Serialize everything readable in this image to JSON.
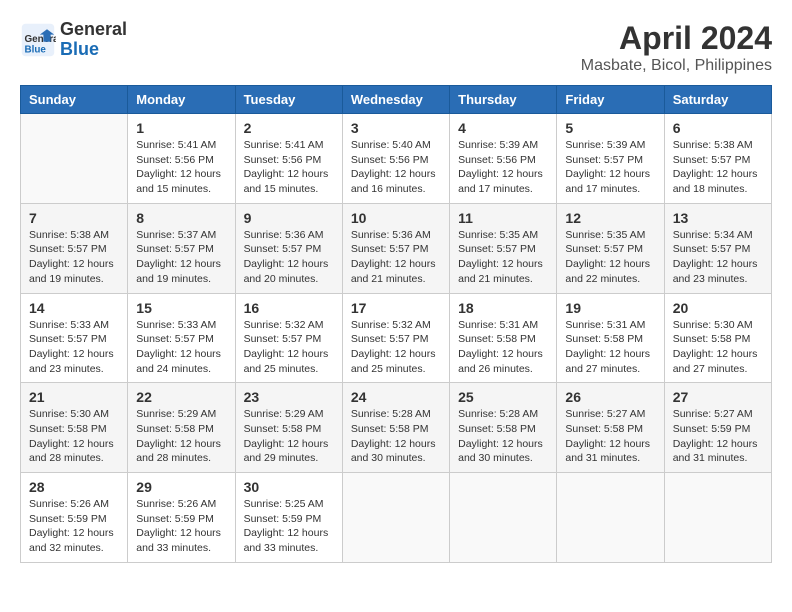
{
  "header": {
    "logo_line1": "General",
    "logo_line2": "Blue",
    "title": "April 2024",
    "subtitle": "Masbate, Bicol, Philippines"
  },
  "columns": [
    "Sunday",
    "Monday",
    "Tuesday",
    "Wednesday",
    "Thursday",
    "Friday",
    "Saturday"
  ],
  "weeks": [
    [
      {
        "day": "",
        "info": ""
      },
      {
        "day": "1",
        "info": "Sunrise: 5:41 AM\nSunset: 5:56 PM\nDaylight: 12 hours\nand 15 minutes."
      },
      {
        "day": "2",
        "info": "Sunrise: 5:41 AM\nSunset: 5:56 PM\nDaylight: 12 hours\nand 15 minutes."
      },
      {
        "day": "3",
        "info": "Sunrise: 5:40 AM\nSunset: 5:56 PM\nDaylight: 12 hours\nand 16 minutes."
      },
      {
        "day": "4",
        "info": "Sunrise: 5:39 AM\nSunset: 5:56 PM\nDaylight: 12 hours\nand 17 minutes."
      },
      {
        "day": "5",
        "info": "Sunrise: 5:39 AM\nSunset: 5:57 PM\nDaylight: 12 hours\nand 17 minutes."
      },
      {
        "day": "6",
        "info": "Sunrise: 5:38 AM\nSunset: 5:57 PM\nDaylight: 12 hours\nand 18 minutes."
      }
    ],
    [
      {
        "day": "7",
        "info": "Sunrise: 5:38 AM\nSunset: 5:57 PM\nDaylight: 12 hours\nand 19 minutes."
      },
      {
        "day": "8",
        "info": "Sunrise: 5:37 AM\nSunset: 5:57 PM\nDaylight: 12 hours\nand 19 minutes."
      },
      {
        "day": "9",
        "info": "Sunrise: 5:36 AM\nSunset: 5:57 PM\nDaylight: 12 hours\nand 20 minutes."
      },
      {
        "day": "10",
        "info": "Sunrise: 5:36 AM\nSunset: 5:57 PM\nDaylight: 12 hours\nand 21 minutes."
      },
      {
        "day": "11",
        "info": "Sunrise: 5:35 AM\nSunset: 5:57 PM\nDaylight: 12 hours\nand 21 minutes."
      },
      {
        "day": "12",
        "info": "Sunrise: 5:35 AM\nSunset: 5:57 PM\nDaylight: 12 hours\nand 22 minutes."
      },
      {
        "day": "13",
        "info": "Sunrise: 5:34 AM\nSunset: 5:57 PM\nDaylight: 12 hours\nand 23 minutes."
      }
    ],
    [
      {
        "day": "14",
        "info": "Sunrise: 5:33 AM\nSunset: 5:57 PM\nDaylight: 12 hours\nand 23 minutes."
      },
      {
        "day": "15",
        "info": "Sunrise: 5:33 AM\nSunset: 5:57 PM\nDaylight: 12 hours\nand 24 minutes."
      },
      {
        "day": "16",
        "info": "Sunrise: 5:32 AM\nSunset: 5:57 PM\nDaylight: 12 hours\nand 25 minutes."
      },
      {
        "day": "17",
        "info": "Sunrise: 5:32 AM\nSunset: 5:57 PM\nDaylight: 12 hours\nand 25 minutes."
      },
      {
        "day": "18",
        "info": "Sunrise: 5:31 AM\nSunset: 5:58 PM\nDaylight: 12 hours\nand 26 minutes."
      },
      {
        "day": "19",
        "info": "Sunrise: 5:31 AM\nSunset: 5:58 PM\nDaylight: 12 hours\nand 27 minutes."
      },
      {
        "day": "20",
        "info": "Sunrise: 5:30 AM\nSunset: 5:58 PM\nDaylight: 12 hours\nand 27 minutes."
      }
    ],
    [
      {
        "day": "21",
        "info": "Sunrise: 5:30 AM\nSunset: 5:58 PM\nDaylight: 12 hours\nand 28 minutes."
      },
      {
        "day": "22",
        "info": "Sunrise: 5:29 AM\nSunset: 5:58 PM\nDaylight: 12 hours\nand 28 minutes."
      },
      {
        "day": "23",
        "info": "Sunrise: 5:29 AM\nSunset: 5:58 PM\nDaylight: 12 hours\nand 29 minutes."
      },
      {
        "day": "24",
        "info": "Sunrise: 5:28 AM\nSunset: 5:58 PM\nDaylight: 12 hours\nand 30 minutes."
      },
      {
        "day": "25",
        "info": "Sunrise: 5:28 AM\nSunset: 5:58 PM\nDaylight: 12 hours\nand 30 minutes."
      },
      {
        "day": "26",
        "info": "Sunrise: 5:27 AM\nSunset: 5:58 PM\nDaylight: 12 hours\nand 31 minutes."
      },
      {
        "day": "27",
        "info": "Sunrise: 5:27 AM\nSunset: 5:59 PM\nDaylight: 12 hours\nand 31 minutes."
      }
    ],
    [
      {
        "day": "28",
        "info": "Sunrise: 5:26 AM\nSunset: 5:59 PM\nDaylight: 12 hours\nand 32 minutes."
      },
      {
        "day": "29",
        "info": "Sunrise: 5:26 AM\nSunset: 5:59 PM\nDaylight: 12 hours\nand 33 minutes."
      },
      {
        "day": "30",
        "info": "Sunrise: 5:25 AM\nSunset: 5:59 PM\nDaylight: 12 hours\nand 33 minutes."
      },
      {
        "day": "",
        "info": ""
      },
      {
        "day": "",
        "info": ""
      },
      {
        "day": "",
        "info": ""
      },
      {
        "day": "",
        "info": ""
      }
    ]
  ]
}
